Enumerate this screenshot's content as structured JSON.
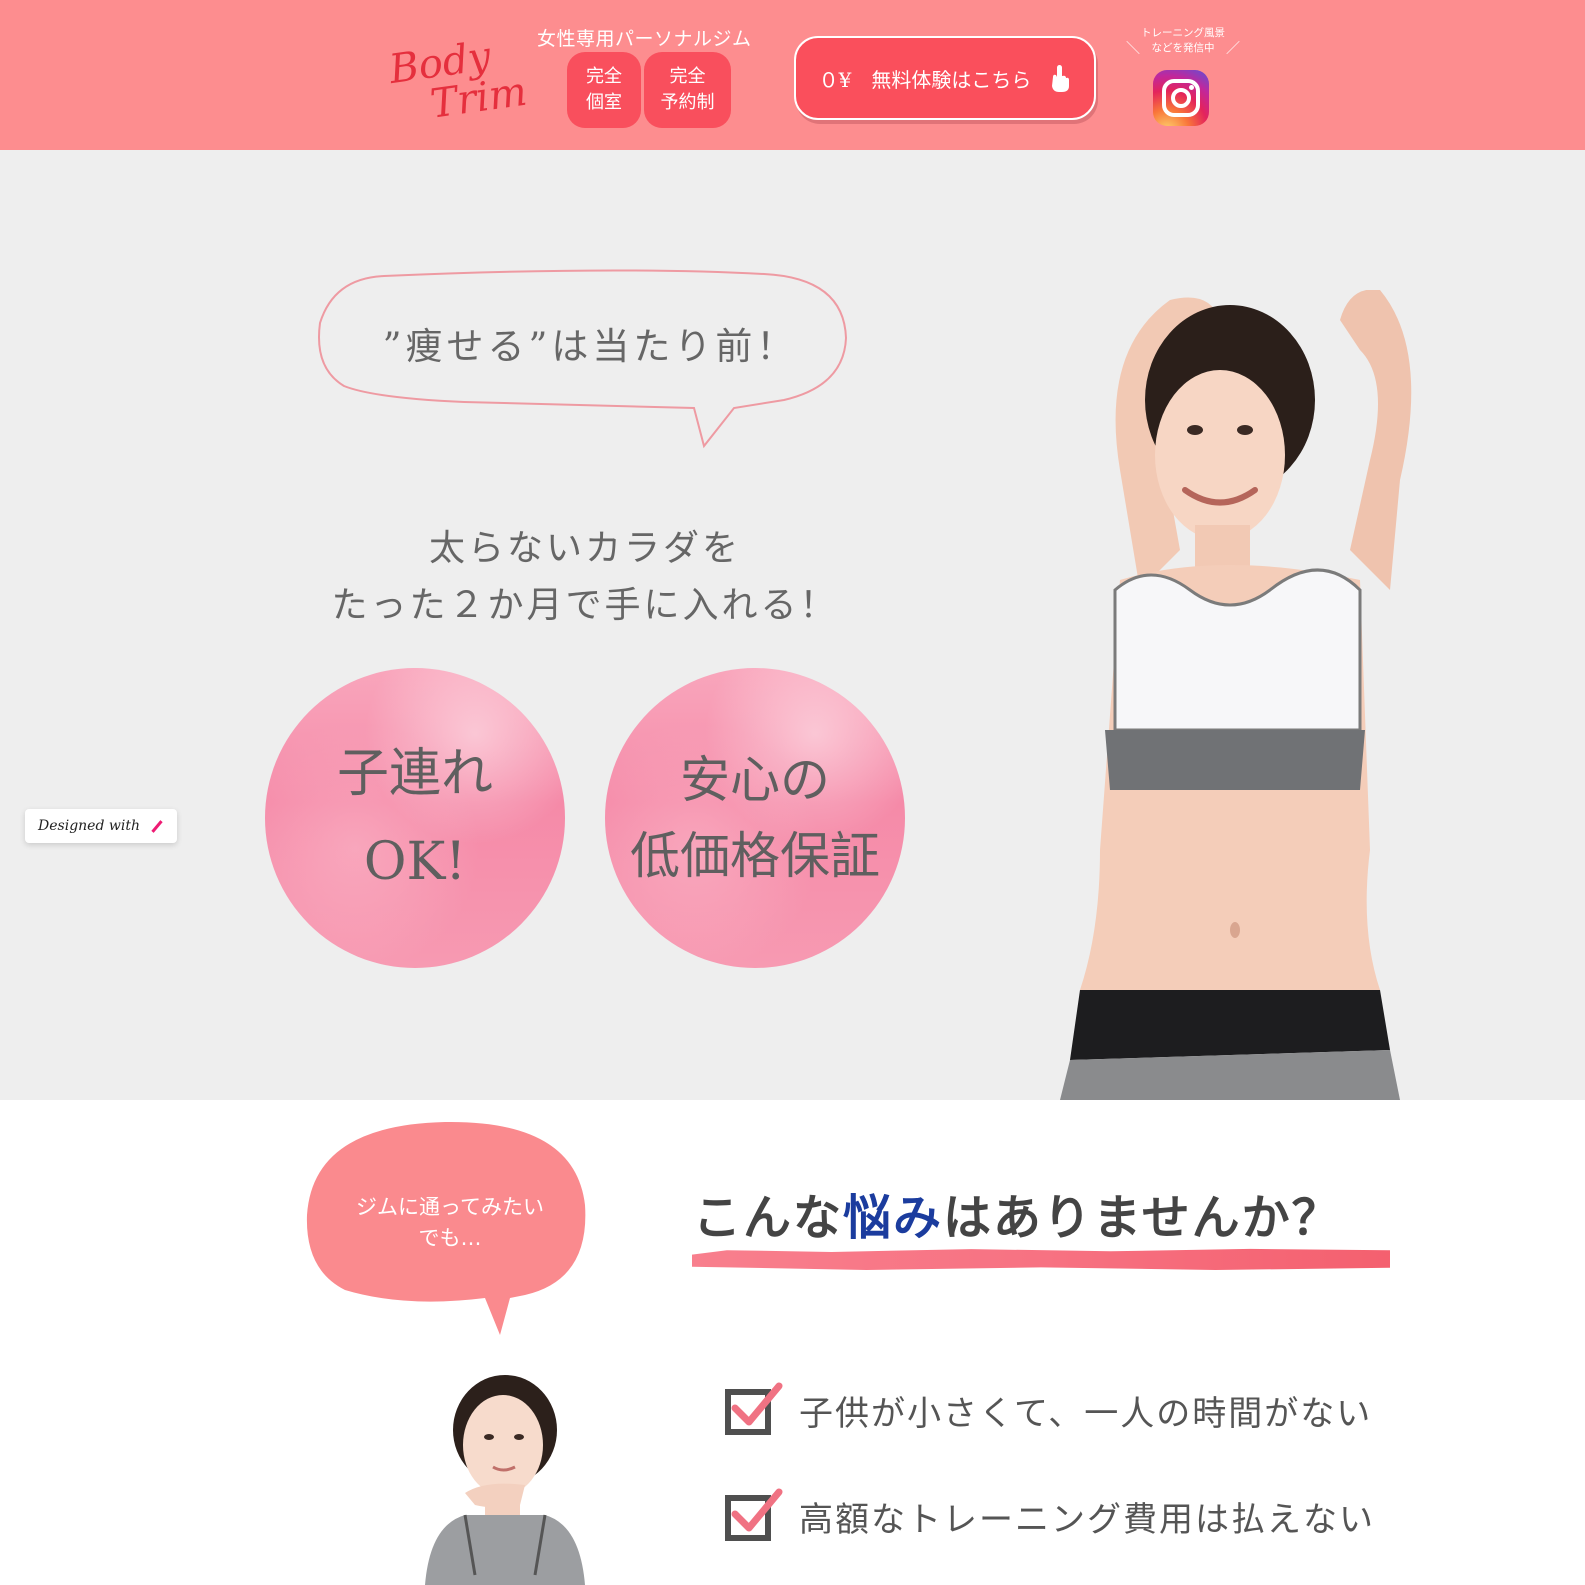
{
  "header": {
    "logo_line1": "Body",
    "logo_line2": "Trim",
    "tagline": "女性専用パーソナルジム",
    "tag_private": "完全\n個室",
    "tag_reservation": "完全\n予約制",
    "cta_label": "０¥　無料体験はこちら",
    "instagram_caption_line1": "トレーニング風景",
    "instagram_caption_line2": "などを発信中",
    "icons": {
      "cta": "hand-pointer-icon",
      "social": "instagram-icon"
    }
  },
  "hero": {
    "quote": "”痩せる”は当たり前！",
    "lead_line1": "太らないカラダを",
    "lead_line2": "たった２か月で手に入れる！",
    "circle_a_line1": "子連れ",
    "circle_a_line2": "OK!",
    "circle_b_line1": "安心の",
    "circle_b_line2": "低価格保証"
  },
  "badge": {
    "designed_with": "Designed with"
  },
  "troubles": {
    "speech": "ジムに通ってみたい\nでも…",
    "title_pre": "こんな",
    "title_accent": "悩み",
    "title_post": "はありませんか？",
    "items": [
      "子供が小さくて、一人の時間がない",
      "高額なトレーニング費用は払えない"
    ]
  },
  "colors": {
    "header_bg": "#fd8d8f",
    "brand_red": "#f94f5d",
    "hero_bg": "#eeeeee",
    "circle_pink": "#f58aa8",
    "accent_blue": "#1b3c9e"
  }
}
